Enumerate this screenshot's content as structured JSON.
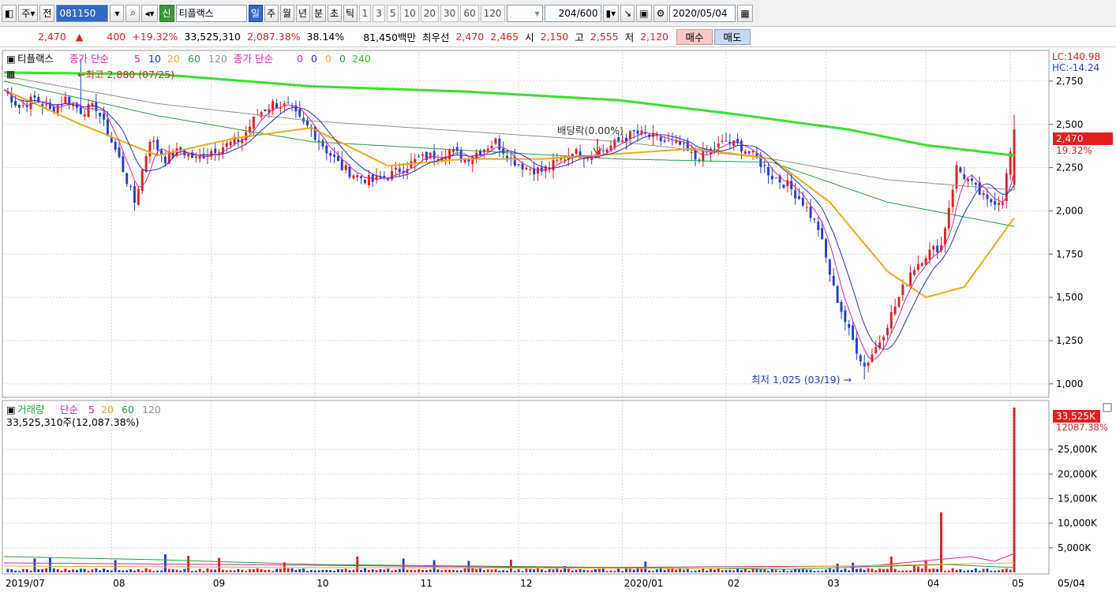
{
  "toolbar": {
    "type_select": "주",
    "prev_label": "전",
    "stock_code": "081150",
    "credit_badge": "신",
    "stock_name": "티플랙스",
    "periods": [
      "일",
      "주",
      "월",
      "년",
      "분",
      "초",
      "틱"
    ],
    "active_period": "일",
    "minute_units": [
      "1",
      "3",
      "5",
      "10",
      "20",
      "30",
      "60",
      "120"
    ],
    "count_display": "204",
    "count_total": "/600",
    "date": "2020/05/04"
  },
  "info": {
    "price": "2,470",
    "change_arrow": "▲",
    "change": "400",
    "change_pct": "+19.32%",
    "volume": "33,525,310",
    "volume_ratio": "2,087.38%",
    "turnover": "38.14%",
    "amount": "81,450백만",
    "best_quote_label": "최우선",
    "ask": "2,470",
    "bid": "2,465",
    "open_label": "시",
    "open": "2,150",
    "high_label": "고",
    "high": "2,555",
    "low_label": "저",
    "low": "2,120",
    "buy_label": "매수",
    "sell_label": "매도"
  },
  "price_panel": {
    "legend_name": "티플랙스",
    "legend_ma1": "종가 단순",
    "legend_ma1_periods": [
      "5",
      "10",
      "20",
      "60",
      "120"
    ],
    "legend_ma2": "종가 단순",
    "legend_ma2_periods": [
      "0",
      "0",
      "0",
      "0",
      "240"
    ],
    "lc_label": "LC:140.98",
    "hc_label": "HC:-14.24",
    "high_marker": "←최고 2,880 (07/25)",
    "low_marker": "최저 1,025 (03/19) →",
    "dividend_marker": "배당락(0.00%)",
    "last_price_tag": "2,470",
    "last_pct_tag": "19.32%",
    "y_ticks": [
      "2,750",
      "2,500",
      "2,250",
      "2,000",
      "1,750",
      "1,500",
      "1,250",
      "1,000"
    ]
  },
  "volume_panel": {
    "legend_name": "거래량",
    "legend_ma": "단순",
    "legend_ma_periods": [
      "5",
      "20",
      "60",
      "120"
    ],
    "summary": "33,525,310주(12,087.38%)",
    "last_volume_tag": "33,525K",
    "last_pct_tag": "12087.38%",
    "y_ticks": [
      "25,000K",
      "20,000K",
      "15,000K",
      "10,000K",
      "5,000K"
    ]
  },
  "x_axis": {
    "labels": [
      "2019/07",
      "08",
      "09",
      "10",
      "11",
      "12",
      "2020/01",
      "02",
      "03",
      "04",
      "05"
    ],
    "right_label": "05/04"
  },
  "colors": {
    "up": "#e0201e",
    "down": "#1f3fd0",
    "ma5": "#e0209e",
    "ma10": "#2030d0",
    "ma20": "#f0a818",
    "ma60": "#20a040",
    "ma120": "#909090",
    "ma240": "#38e030"
  },
  "chart_data": {
    "type": "candlestick",
    "price_range": [
      940,
      2900
    ],
    "volume_range": [
      0,
      34000
    ],
    "months": [
      "2019/07",
      "08",
      "09",
      "10",
      "11",
      "12",
      "2020/01",
      "02",
      "03",
      "04",
      "05"
    ],
    "close_path": [
      [
        0,
        2700
      ],
      [
        4,
        2600
      ],
      [
        8,
        2650
      ],
      [
        12,
        2580
      ],
      [
        16,
        2650
      ],
      [
        20,
        2580
      ],
      [
        24,
        2600
      ],
      [
        26,
        2500
      ],
      [
        30,
        2300
      ],
      [
        34,
        2050
      ],
      [
        38,
        2420
      ],
      [
        42,
        2300
      ],
      [
        46,
        2350
      ],
      [
        50,
        2300
      ],
      [
        54,
        2350
      ],
      [
        58,
        2380
      ],
      [
        62,
        2420
      ],
      [
        66,
        2560
      ],
      [
        70,
        2620
      ],
      [
        74,
        2600
      ],
      [
        78,
        2500
      ],
      [
        80,
        2470
      ],
      [
        84,
        2350
      ],
      [
        88,
        2250
      ],
      [
        92,
        2200
      ],
      [
        96,
        2170
      ],
      [
        100,
        2200
      ],
      [
        104,
        2250
      ],
      [
        108,
        2300
      ],
      [
        112,
        2320
      ],
      [
        116,
        2350
      ],
      [
        120,
        2300
      ],
      [
        124,
        2350
      ],
      [
        128,
        2400
      ],
      [
        132,
        2300
      ],
      [
        136,
        2250
      ],
      [
        140,
        2230
      ],
      [
        144,
        2280
      ],
      [
        148,
        2340
      ],
      [
        152,
        2320
      ],
      [
        156,
        2350
      ],
      [
        160,
        2400
      ],
      [
        164,
        2450
      ],
      [
        168,
        2430
      ],
      [
        172,
        2400
      ],
      [
        176,
        2380
      ],
      [
        180,
        2300
      ],
      [
        184,
        2350
      ],
      [
        188,
        2400
      ],
      [
        192,
        2370
      ],
      [
        196,
        2300
      ],
      [
        200,
        2200
      ],
      [
        204,
        2150
      ],
      [
        208,
        2050
      ],
      [
        212,
        1900
      ],
      [
        216,
        1550
      ],
      [
        220,
        1300
      ],
      [
        224,
        1100
      ],
      [
        228,
        1250
      ],
      [
        232,
        1450
      ],
      [
        236,
        1650
      ],
      [
        240,
        1750
      ],
      [
        244,
        1800
      ],
      [
        248,
        2250
      ],
      [
        252,
        2150
      ],
      [
        256,
        2050
      ],
      [
        260,
        2070
      ],
      [
        263,
        2470
      ]
    ],
    "ma240_path": [
      [
        0,
        2800
      ],
      [
        40,
        2790
      ],
      [
        80,
        2720
      ],
      [
        120,
        2690
      ],
      [
        160,
        2640
      ],
      [
        190,
        2560
      ],
      [
        220,
        2470
      ],
      [
        240,
        2380
      ],
      [
        263,
        2320
      ]
    ],
    "ma120_path": [
      [
        0,
        2780
      ],
      [
        40,
        2620
      ],
      [
        80,
        2520
      ],
      [
        120,
        2460
      ],
      [
        160,
        2400
      ],
      [
        200,
        2300
      ],
      [
        230,
        2180
      ],
      [
        263,
        2120
      ]
    ],
    "ma60_path": [
      [
        0,
        2750
      ],
      [
        40,
        2550
      ],
      [
        80,
        2400
      ],
      [
        120,
        2350
      ],
      [
        160,
        2300
      ],
      [
        200,
        2280
      ],
      [
        230,
        2050
      ],
      [
        263,
        1910
      ]
    ],
    "ma20_path": [
      [
        0,
        2700
      ],
      [
        20,
        2500
      ],
      [
        40,
        2320
      ],
      [
        60,
        2420
      ],
      [
        80,
        2480
      ],
      [
        100,
        2260
      ],
      [
        120,
        2300
      ],
      [
        140,
        2300
      ],
      [
        160,
        2330
      ],
      [
        180,
        2360
      ],
      [
        200,
        2300
      ],
      [
        215,
        2050
      ],
      [
        230,
        1650
      ],
      [
        240,
        1500
      ],
      [
        250,
        1560
      ],
      [
        263,
        1960
      ]
    ],
    "spikes": {
      "high": {
        "x": 20,
        "value": 2880
      },
      "low": {
        "x": 224,
        "value": 1025
      },
      "last_volume": 33525,
      "april_volume": 12200
    }
  }
}
